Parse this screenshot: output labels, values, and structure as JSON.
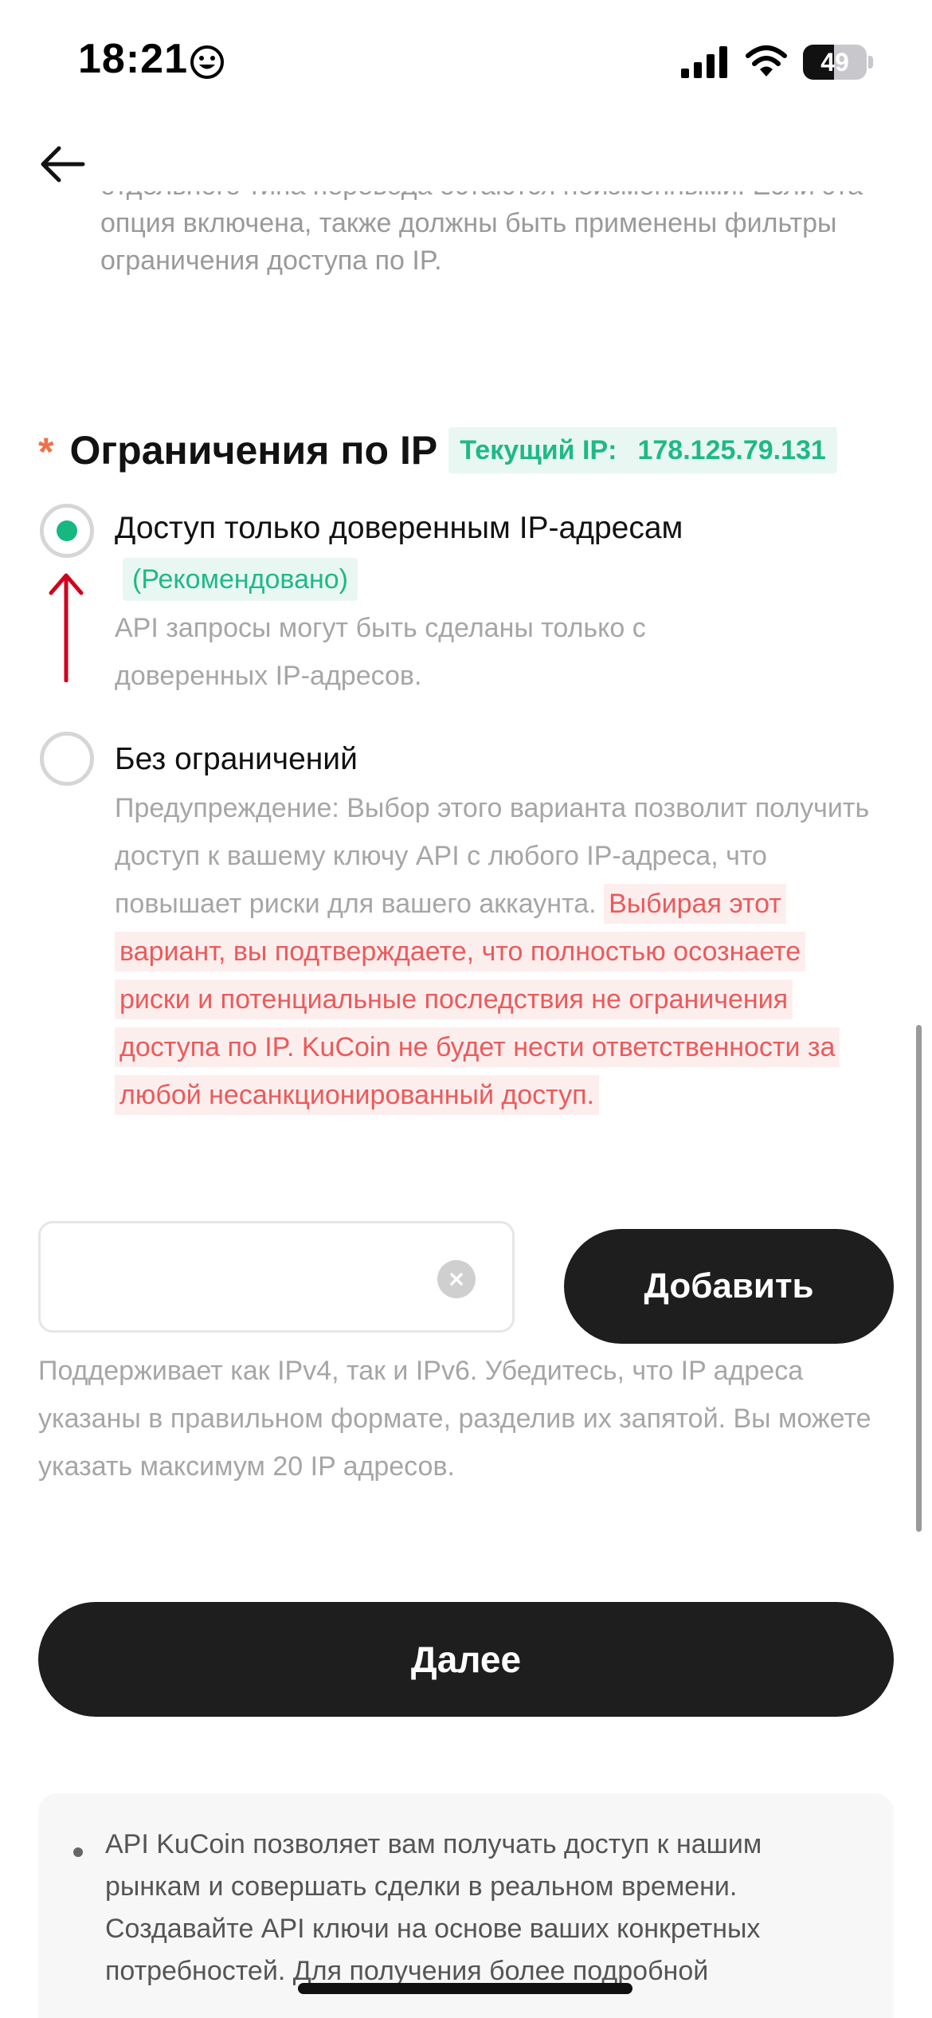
{
  "status_bar": {
    "time": "18:21",
    "battery": "49",
    "icons": [
      "smiley-icon",
      "signal-icon",
      "wifi-icon",
      "battery-icon"
    ]
  },
  "header": {
    "back_icon": "arrow-left-icon"
  },
  "top_description": "отдельного типа перевода остаются неизменными. Если эта опция включена, также должны быть применены фильтры ограничения доступа по IP.",
  "ip_section": {
    "required_mark": "*",
    "title": "Ограничения по IP",
    "current_ip_label": "Текущий IP:",
    "current_ip_value": "178.125.79.131"
  },
  "options": [
    {
      "title": "Доступ только доверенным IP-адресам",
      "badge": "(Рекомендовано)",
      "description": "API запросы могут быть сделаны только с доверенных IP-адресов.",
      "selected": true
    },
    {
      "title": "Без ограничений",
      "description": "Предупреждение: Выбор этого варианта позволит получить доступ к вашему ключу API с любого IP-адреса, что повышает риски для вашего аккаунта.",
      "warning": "Выбирая этот вариант, вы подтверждаете, что полностью осознаете риски и потенциальные последствия не ограничения доступа по IP. KuCoin не будет нести ответственности за любой несанкционированный доступ.",
      "selected": false
    }
  ],
  "ip_input": {
    "value": "",
    "placeholder": ""
  },
  "add_button_label": "Добавить",
  "input_hint": "Поддерживает как IPv4, так и IPv6. Убедитесь, что IP адреса указаны в правильном формате, разделив их запятой. Вы можете указать максимум 20 IP адресов.",
  "next_button_label": "Далее",
  "info": {
    "text": "API KuCoin позволяет вам получать доступ к нашим рынкам и совершать сделки в реальном времени. Создавайте API ключи на основе ваших конкретных потребностей. Для получения более подробной"
  },
  "colors": {
    "accent_green": "#16b880",
    "warning_red": "#ec5a5a",
    "annotation_red": "#d0021b",
    "button_dark": "#1e1e1e"
  }
}
